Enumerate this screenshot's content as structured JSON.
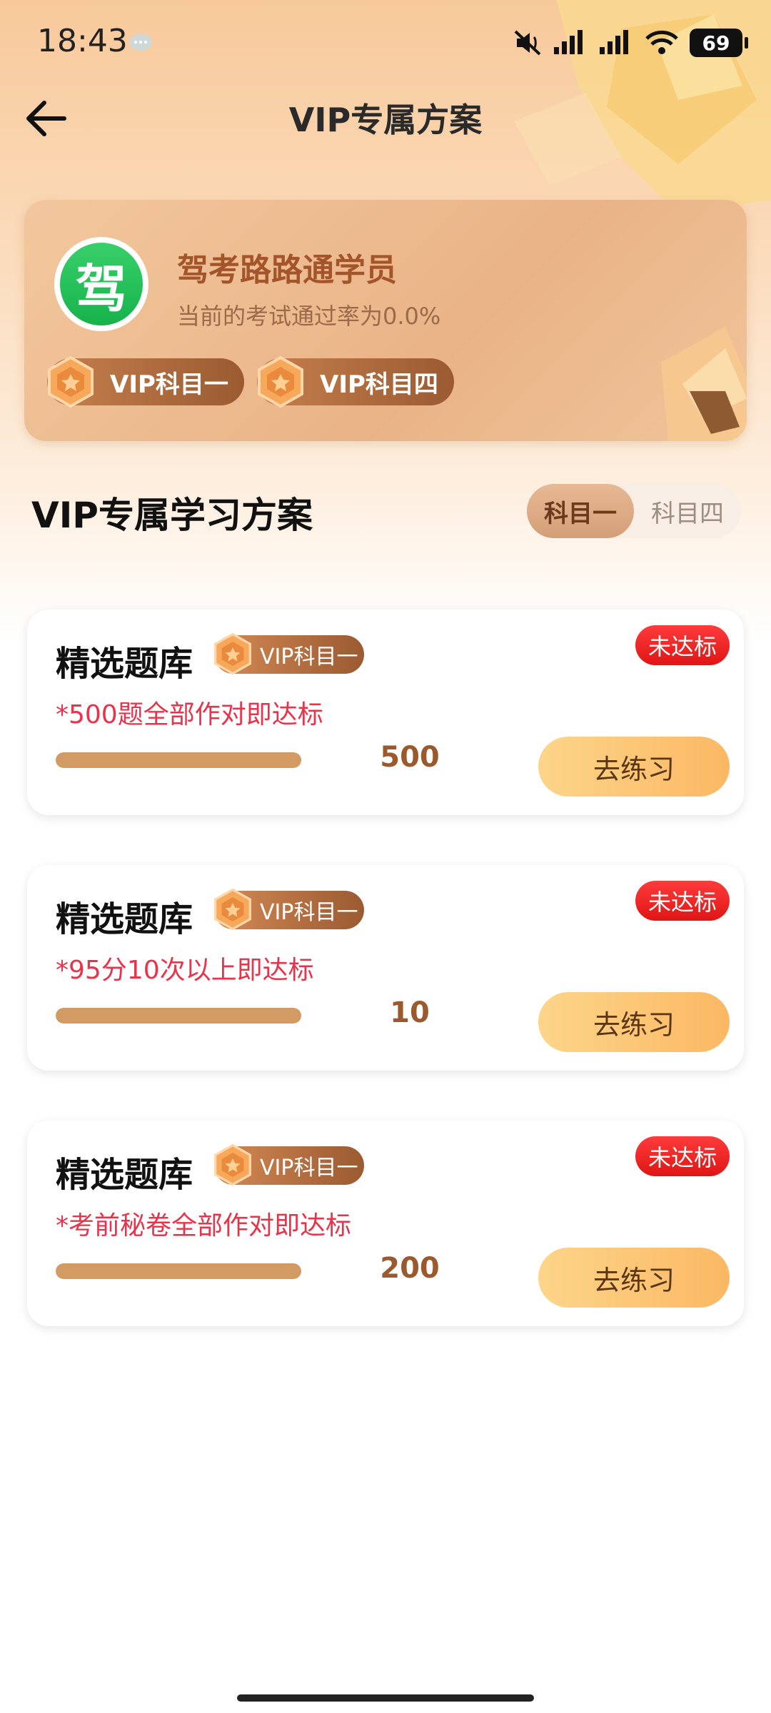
{
  "status_bar": {
    "time": "18:43",
    "battery": "69"
  },
  "header": {
    "title": "VIP专属方案"
  },
  "profile": {
    "avatar_char": "驾",
    "name": "驾考路路通学员",
    "pass_rate_text": "当前的考试通过率为0.0%",
    "vip_badges": [
      "VIP科目一",
      "VIP科目四"
    ]
  },
  "section": {
    "title": "VIP专属学习方案",
    "tabs": [
      {
        "label": "科目一",
        "selected": true
      },
      {
        "label": "科目四",
        "selected": false
      }
    ]
  },
  "tasks": [
    {
      "title": "精选题库",
      "vip_label": "VIP科目一",
      "status": "未达标",
      "requirement": "*500题全部作对即达标",
      "target": "500",
      "progress": 1.0,
      "button": "去练习"
    },
    {
      "title": "精选题库",
      "vip_label": "VIP科目一",
      "status": "未达标",
      "requirement": "*95分10次以上即达标",
      "target": "10",
      "progress": 1.0,
      "button": "去练习"
    },
    {
      "title": "精选题库",
      "vip_label": "VIP科目一",
      "status": "未达标",
      "requirement": "*考前秘卷全部作对即达标",
      "target": "200",
      "progress": 1.0,
      "button": "去练习"
    }
  ],
  "colors": {
    "accent": "#fbb863",
    "status_red": "#e01515",
    "brown": "#9b5a31"
  }
}
